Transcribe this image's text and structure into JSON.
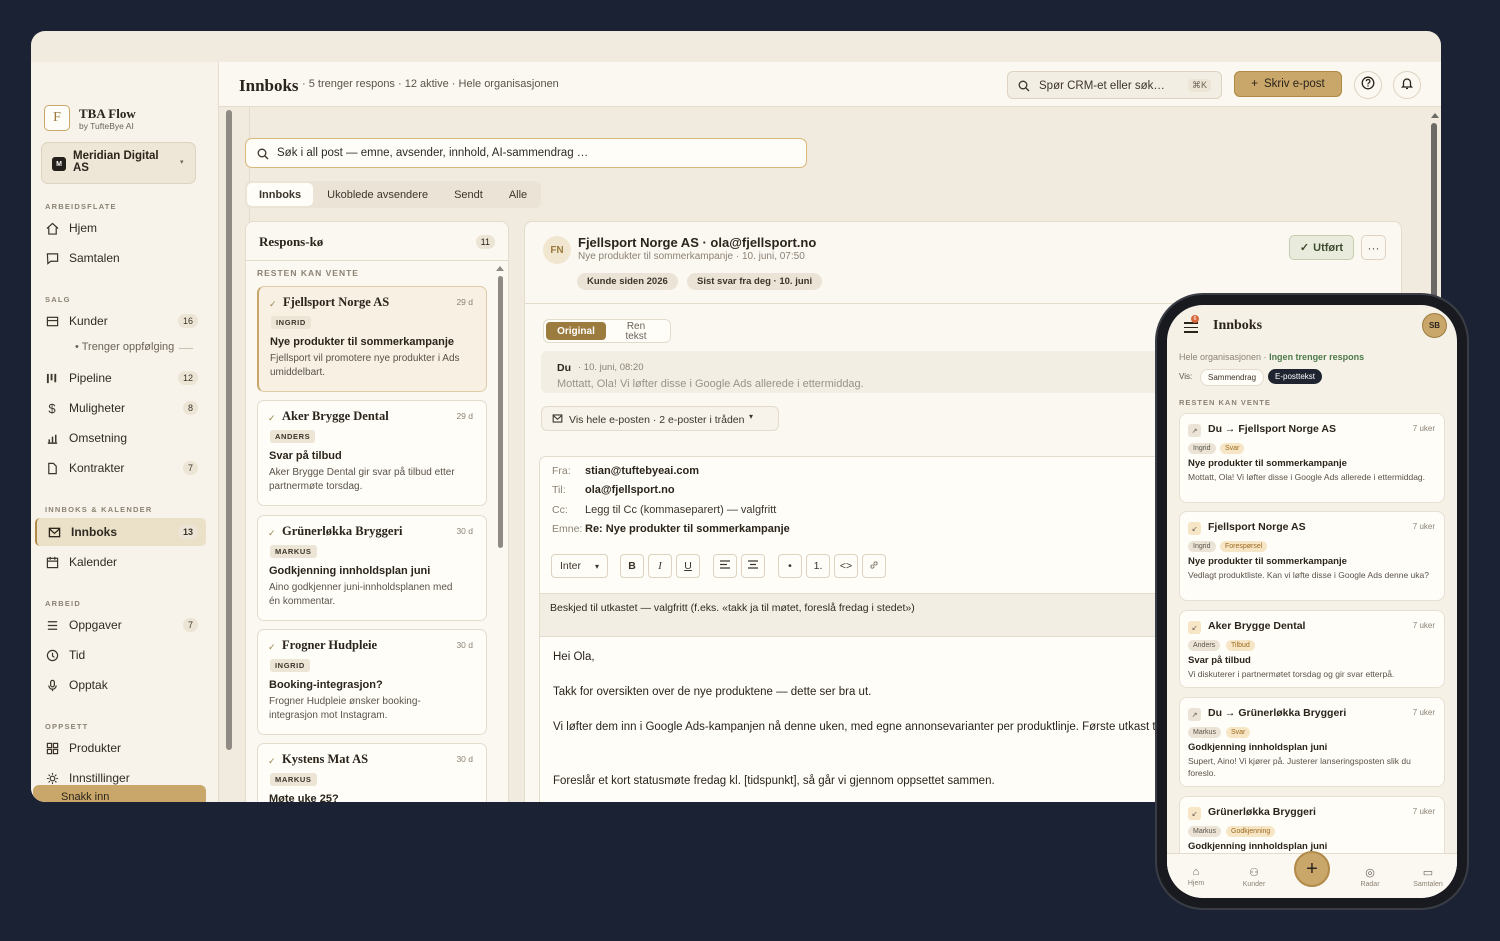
{
  "app": {
    "name": "TBA Flow",
    "sub": "by TufteBye AI",
    "logo": "F"
  },
  "org": {
    "initial": "M",
    "name": "Meridian Digital AS"
  },
  "sidebar": {
    "sections": [
      "ARBEIDSFLATE",
      "SALG",
      "INNBOKS & KALENDER",
      "ARBEID",
      "OPPSETT"
    ],
    "items": [
      {
        "label": "Hjem",
        "icon": "home-icon"
      },
      {
        "label": "Samtalen",
        "icon": "chat-icon"
      },
      {
        "label": "Kunder",
        "icon": "customers-icon",
        "badge": "16"
      },
      {
        "label": "Trenger oppfølging"
      },
      {
        "label": "Pipeline",
        "icon": "pipeline-icon",
        "badge": "12"
      },
      {
        "label": "Muligheter",
        "icon": "dollar-icon",
        "badge": "8"
      },
      {
        "label": "Omsetning",
        "icon": "bar-chart-icon"
      },
      {
        "label": "Kontrakter",
        "icon": "document-icon",
        "badge": "7"
      },
      {
        "label": "Innboks",
        "icon": "mail-icon",
        "badge": "13"
      },
      {
        "label": "Kalender",
        "icon": "calendar-icon"
      },
      {
        "label": "Oppgaver",
        "icon": "list-icon",
        "badge": "7"
      },
      {
        "label": "Tid",
        "icon": "clock-icon"
      },
      {
        "label": "Opptak",
        "icon": "mic-icon"
      },
      {
        "label": "Produkter",
        "icon": "grid-icon"
      },
      {
        "label": "Innstillinger",
        "icon": "gear-icon"
      }
    ],
    "chat_btn": "Snakk inn"
  },
  "topbar": {
    "title": "Innboks",
    "subtitle": "· 5 trenger respons · 12 aktive · Hele organisasjonen",
    "search": "Spør CRM-et eller søk…",
    "kbd": "⌘K",
    "compose": "Skriv e-post"
  },
  "main": {
    "search": "Søk i all post — emne, avsender, innhold, AI-sammendrag …",
    "tabs": [
      "Innboks",
      "Ukoblede avsendere",
      "Sendt",
      "Alle"
    ]
  },
  "queue": {
    "title": "Respons-kø",
    "count": "11",
    "label": "RESTEN KAN VENTE",
    "cards": [
      {
        "name": "Fjellsport Norge AS",
        "date": "29 d",
        "tag": "INGRID",
        "subject": "Nye produkter til sommerkampanje",
        "preview": "Fjellsport vil promotere nye produkter i Ads umiddelbart."
      },
      {
        "name": "Aker Brygge Dental",
        "date": "29 d",
        "tag": "ANDERS",
        "subject": "Svar på tilbud",
        "preview": "Aker Brygge Dental gir svar på tilbud etter partnermøte torsdag."
      },
      {
        "name": "Grünerløkka Bryggeri",
        "date": "30 d",
        "tag": "MARKUS",
        "subject": "Godkjenning innholdsplan juni",
        "preview": "Aino godkjenner juni-innholdsplanen med én kommentar."
      },
      {
        "name": "Frogner Hudpleie",
        "date": "30 d",
        "tag": "INGRID",
        "subject": "Booking-integrasjon?",
        "preview": "Frogner Hudpleie ønsker booking-integrasjon mot Instagram."
      },
      {
        "name": "Kystens Mat AS",
        "date": "30 d",
        "tag": "MARKUS",
        "subject": "Møte uke 25?",
        "preview": ""
      }
    ]
  },
  "detail": {
    "initials": "FN",
    "name": "Fjellsport Norge AS · ola@fjellsport.no",
    "sub": "Nye produkter til sommerkampanje · 10. juni, 07:50",
    "chips": [
      "Kunde siden 2026",
      "Sist svar fra deg · 10. juni"
    ],
    "done": "Utført",
    "toggle": [
      "Original",
      "Ren tekst"
    ],
    "prev": {
      "who": "Du",
      "when": "· 10. juni, 08:20",
      "text": "Mottatt, Ola! Vi løfter disse i Google Ads allerede i ettermiddag."
    },
    "show_all": "Vis hele e-posten · 2 e-poster i tråden",
    "compose": {
      "from_l": "Fra:",
      "from": "stian@tuftebyeai.com",
      "to_l": "Til:",
      "to": "ola@fjellsport.no",
      "cc_l": "Cc:",
      "cc": "Legg til Cc (kommaseparert) — valgfritt",
      "subj_l": "Emne:",
      "subj": "Re: Nye produkter til sommerkampanje",
      "font": "Inter",
      "hint": "Beskjed til utkastet — valgfritt (f.eks. «takk ja til møtet, foreslå fredag i stedet»)",
      "body": [
        "Hei Ola,",
        "Takk for oversikten over de nye produktene — dette ser bra ut.",
        "Vi løfter dem inn i Google Ads-kampanjen nå denne uken, med egne annonsevarianter per produktlinje. Første utkast til an",
        "Foreslår et kort statusmøte fredag kl. [tidspunkt], så går vi gjennom oppsettet sammen."
      ]
    }
  },
  "phone": {
    "title": "Innboks",
    "notif": "6",
    "avatar": "SB",
    "org": "Hele organisasjonen · ",
    "org_status": "Ingen trenger respons",
    "vis": "Vis:",
    "pills": [
      "Sammendrag",
      "E-posttekst"
    ],
    "label": "RESTEN KAN VENTE",
    "cards": [
      {
        "icon": "↗",
        "name": "Du → Fjellsport Norge AS",
        "date": "7 uker",
        "tags": [
          "Ingrid",
          "Svar"
        ],
        "subject": "Nye produkter til sommerkampanje",
        "preview": "Mottatt, Ola! Vi løfter disse i Google Ads allerede i ettermiddag."
      },
      {
        "icon": "↙",
        "name": "Fjellsport Norge AS",
        "date": "7 uker",
        "tags": [
          "Ingrid",
          "Forespørsel"
        ],
        "subject": "Nye produkter til sommerkampanje",
        "preview": "Vedlagt produktliste. Kan vi løfte disse i Google Ads denne uka?"
      },
      {
        "icon": "↙",
        "name": "Aker Brygge Dental",
        "date": "7 uker",
        "tags": [
          "Anders",
          "Tilbud"
        ],
        "subject": "Svar på tilbud",
        "preview": "Vi diskuterer i partnermøtet torsdag og gir svar etterpå."
      },
      {
        "icon": "↗",
        "name": "Du → Grünerløkka Bryggeri",
        "date": "7 uker",
        "tags": [
          "Markus",
          "Svar"
        ],
        "subject": "Godkjenning innholdsplan juni",
        "preview": "Supert, Aino! Vi kjører på. Justerer lanseringsposten slik du foreslo."
      },
      {
        "icon": "↙",
        "name": "Grünerløkka Bryggeri",
        "date": "7 uker",
        "tags": [
          "Markus",
          "Godkjenning"
        ],
        "subject": "Godkjenning innholdsplan juni",
        "preview": ""
      }
    ],
    "nav": [
      "Hjem",
      "Kunder",
      "Radar",
      "Samtalen"
    ]
  }
}
